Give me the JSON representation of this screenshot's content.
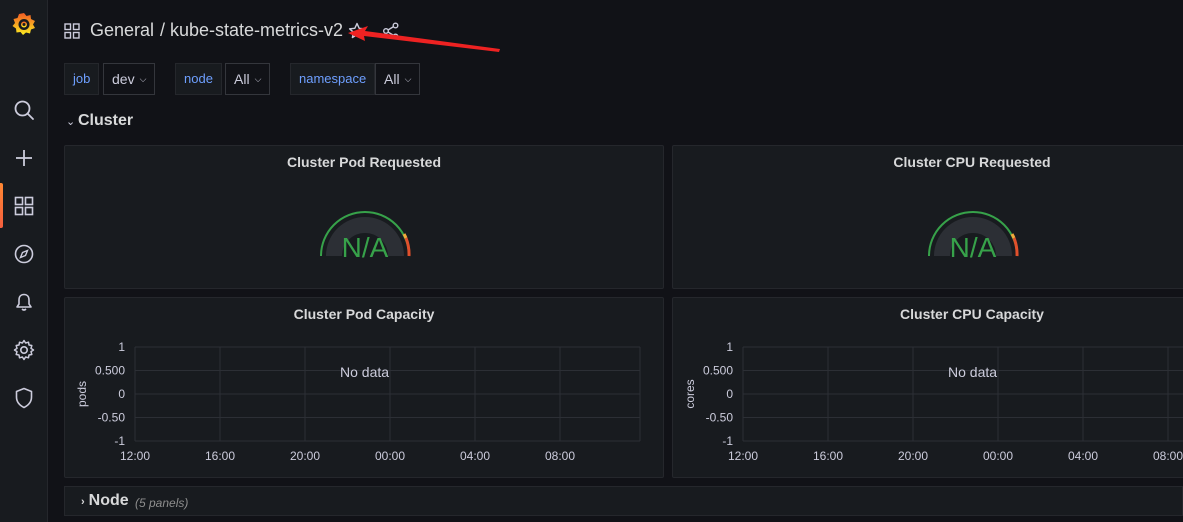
{
  "header": {
    "folder": "General",
    "title": "/ kube-state-metrics-v2"
  },
  "variables": [
    {
      "label": "job",
      "value": "dev"
    },
    {
      "label": "node",
      "value": "All"
    },
    {
      "label": "namespace",
      "value": "All"
    }
  ],
  "rows": {
    "cluster": {
      "title": "Cluster"
    },
    "node": {
      "title": "Node",
      "count": "(5 panels)"
    }
  },
  "panels": {
    "pod_requested": {
      "title": "Cluster Pod Requested",
      "value": "N/A"
    },
    "cpu_requested": {
      "title": "Cluster CPU Requested",
      "value": "N/A"
    },
    "pod_capacity": {
      "title": "Cluster Pod Capacity",
      "ylabel": "pods",
      "nodata": "No data"
    },
    "cpu_capacity": {
      "title": "Cluster CPU Capacity",
      "ylabel": "cores",
      "nodata": "No data"
    }
  },
  "chart_data": [
    {
      "type": "line",
      "title": "Cluster Pod Capacity",
      "ylabel": "pods",
      "x": [
        "12:00",
        "16:00",
        "20:00",
        "00:00",
        "04:00",
        "08:00"
      ],
      "y_ticks": [
        "1",
        "0.500",
        "0",
        "-0.50",
        "-1"
      ],
      "ylim": [
        -1,
        1
      ],
      "series": []
    },
    {
      "type": "line",
      "title": "Cluster CPU Capacity",
      "ylabel": "cores",
      "x": [
        "12:00",
        "16:00",
        "20:00",
        "00:00",
        "04:00",
        "08:00"
      ],
      "y_ticks": [
        "1",
        "0.500",
        "0",
        "-0.50",
        "-1"
      ],
      "ylim": [
        -1,
        1
      ],
      "series": []
    }
  ],
  "sidebar": {
    "icons": [
      "grafana-logo-icon",
      "search-icon",
      "plus-icon",
      "dashboards-icon",
      "explore-icon",
      "alerting-icon",
      "settings-icon",
      "shield-icon"
    ]
  },
  "colors": {
    "accent": "#ff8833",
    "gauge_ok": "#37a24a",
    "gauge_warn": "#f2a93b",
    "gauge_crit": "#e0502c",
    "annotation_arrow": "#ee2222"
  }
}
